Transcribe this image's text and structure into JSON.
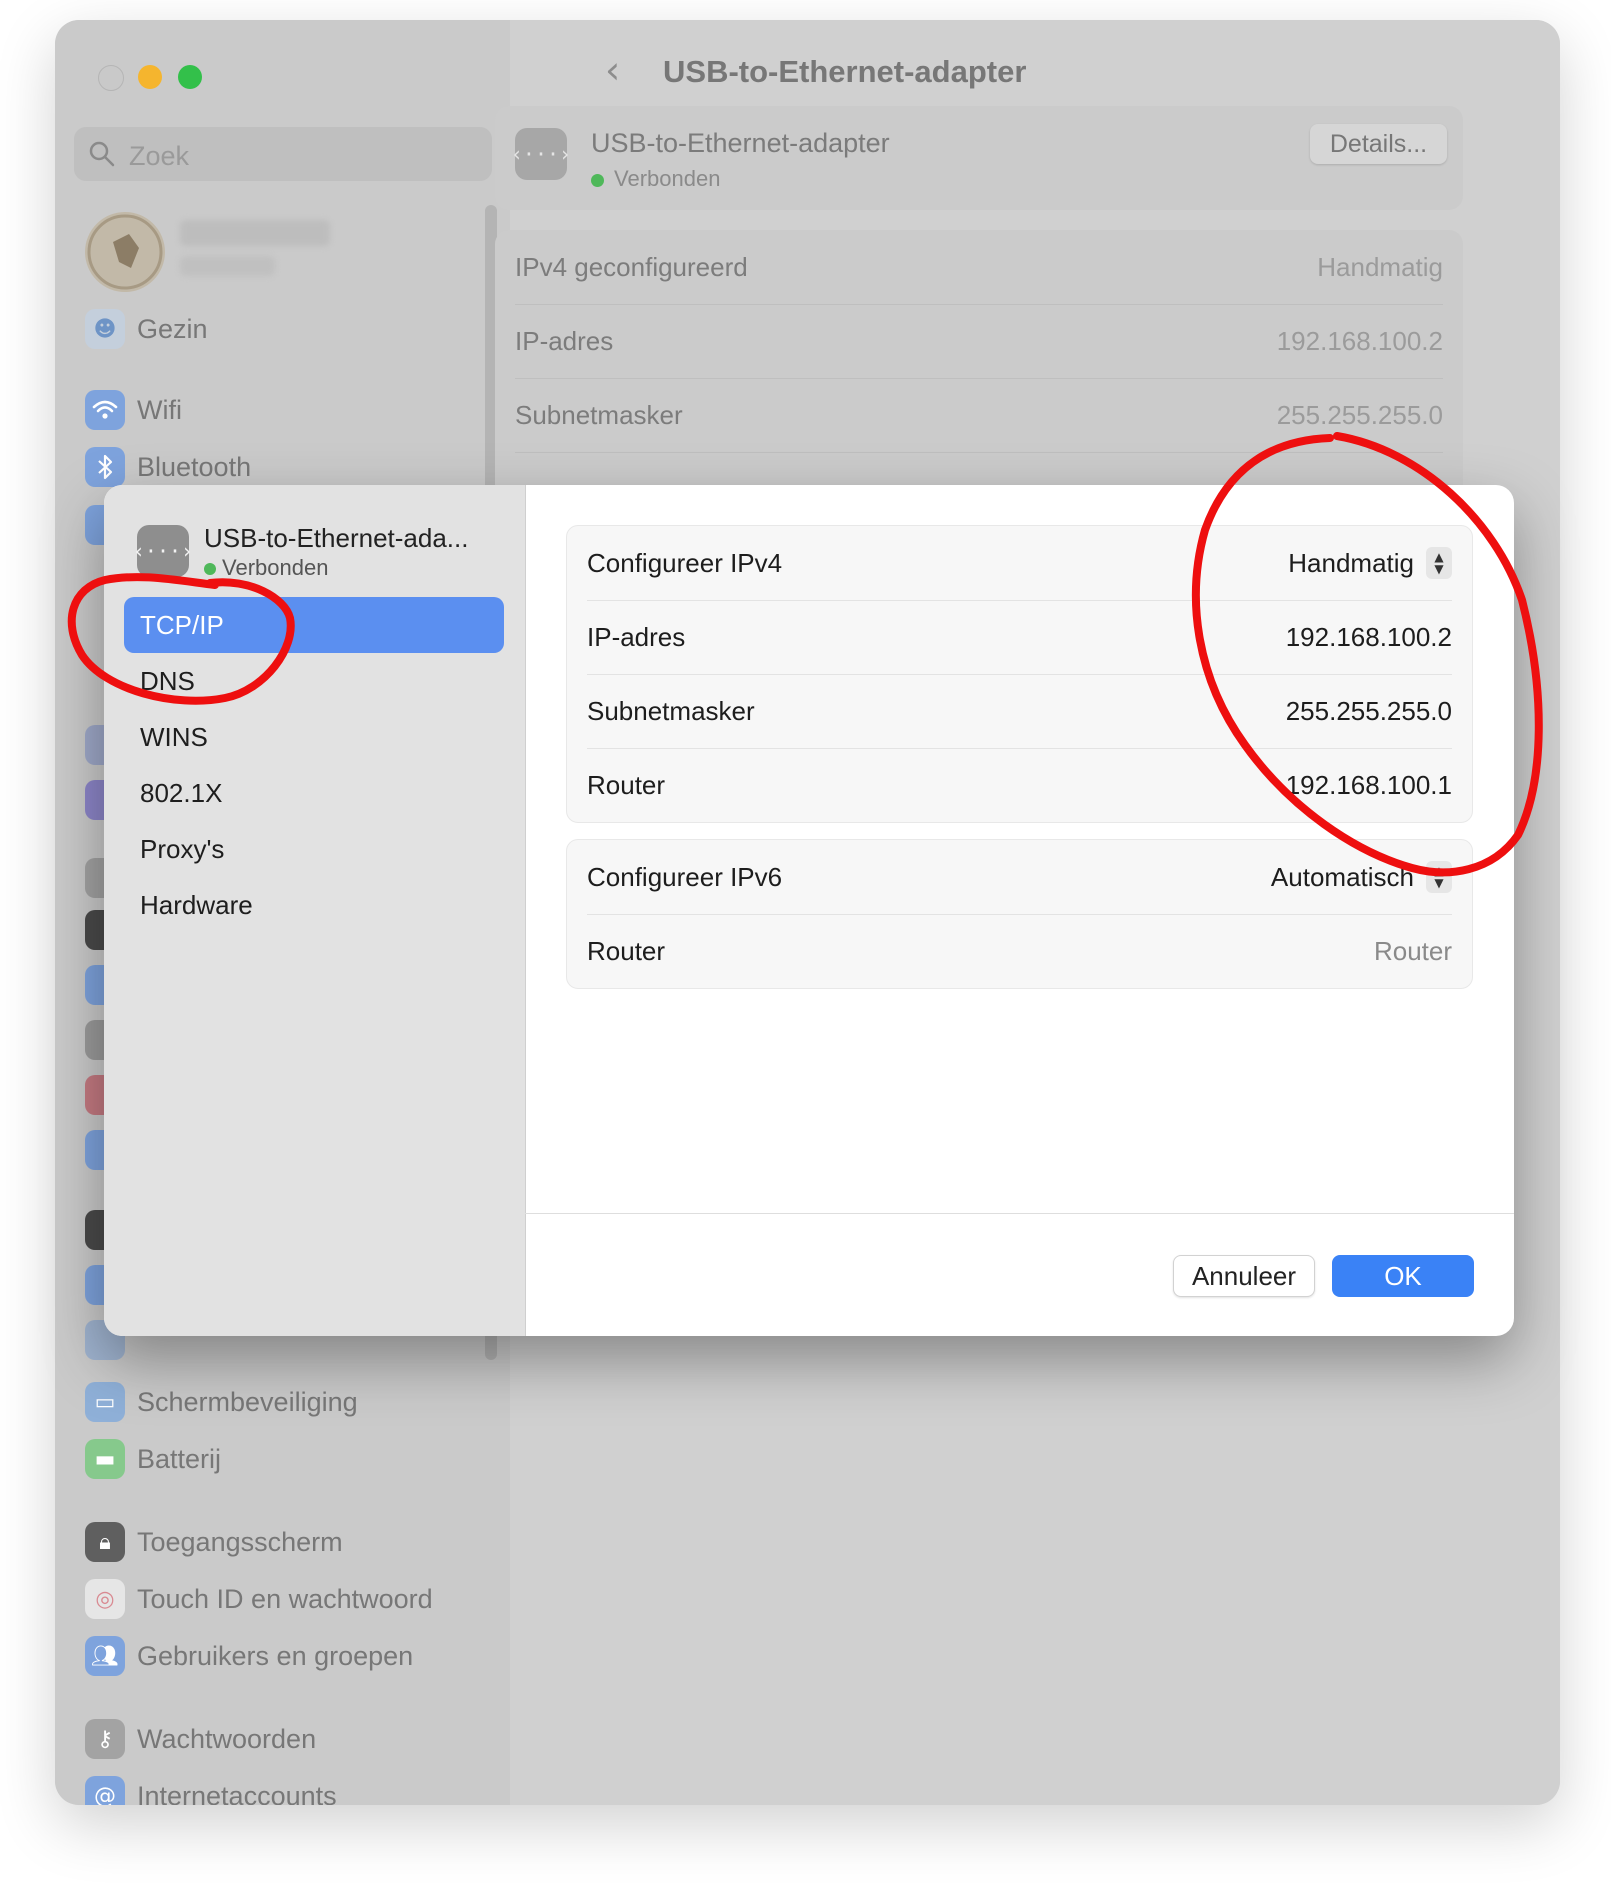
{
  "colors": {
    "accent": "#3a82f6",
    "selection": "#5b8ff0",
    "status_green": "#4fb85a",
    "annotation_red": "#ee0f0f"
  },
  "window": {
    "search": {
      "placeholder": "Zoek",
      "icon": "search-icon"
    },
    "account": {
      "name": "Jonas Baert",
      "subtitle": "Apple ID"
    },
    "sidebar": {
      "items": [
        {
          "label": "Gezin",
          "icon": "family-icon",
          "color": "#8fb5e6"
        },
        {
          "label": "Wifi",
          "icon": "wifi-icon",
          "color": "#5b93ea"
        },
        {
          "label": "Bluetooth",
          "icon": "bluetooth-icon",
          "color": "#5b93ea"
        },
        {
          "label": "Schermbeveiliging",
          "icon": "screensaver-icon",
          "color": "#6fa4e0"
        },
        {
          "label": "Batterij",
          "icon": "battery-icon",
          "color": "#59c262"
        },
        {
          "label": "Toegangsscherm",
          "icon": "lock-icon",
          "color": "#3b3b3b"
        },
        {
          "label": "Touch ID en wachtwoord",
          "icon": "fingerprint-icon",
          "color": "#f3f3f3"
        },
        {
          "label": "Gebruikers en groepen",
          "icon": "users-icon",
          "color": "#5b93ea"
        },
        {
          "label": "Wachtwoorden",
          "icon": "key-icon",
          "color": "#8a8a8a"
        },
        {
          "label": "Internetaccounts",
          "icon": "at-icon",
          "color": "#5b93ea"
        }
      ]
    },
    "main": {
      "title": "USB-to-Ethernet-adapter",
      "adapter": {
        "name": "USB-to-Ethernet-adapter",
        "status": "Verbonden",
        "details_label": "Details..."
      },
      "info_rows": [
        {
          "key": "IPv4 geconfigureerd",
          "value": "Handmatig"
        },
        {
          "key": "IP-adres",
          "value": "192.168.100.2"
        },
        {
          "key": "Subnetmasker",
          "value": "255.255.255.0"
        }
      ]
    }
  },
  "modal": {
    "adapter": {
      "name": "USB-to-Ethernet-ada...",
      "status": "Verbonden"
    },
    "nav": [
      "TCP/IP",
      "DNS",
      "WINS",
      "802.1X",
      "Proxy's",
      "Hardware"
    ],
    "selected_nav": "TCP/IP",
    "ipv4": [
      {
        "key": "Configureer IPv4",
        "value": "Handmatig"
      },
      {
        "key": "IP-adres",
        "value": "192.168.100.2"
      },
      {
        "key": "Subnetmasker",
        "value": "255.255.255.0"
      },
      {
        "key": "Router",
        "value": "192.168.100.1"
      }
    ],
    "ipv6": [
      {
        "key": "Configureer IPv6",
        "value": "Automatisch"
      },
      {
        "key": "Router",
        "placeholder": "Router"
      }
    ],
    "cancel_label": "Annuleer",
    "ok_label": "OK"
  }
}
